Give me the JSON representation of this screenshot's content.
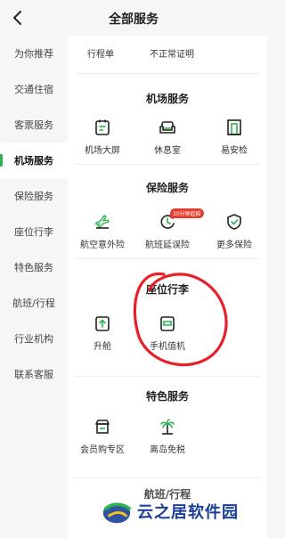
{
  "header": {
    "title": "全部服务"
  },
  "sidebar": {
    "items": [
      {
        "label": "为你推荐"
      },
      {
        "label": "交通住宿"
      },
      {
        "label": "客票服务"
      },
      {
        "label": "机场服务"
      },
      {
        "label": "保险服务"
      },
      {
        "label": "座位行李"
      },
      {
        "label": "特色服务"
      },
      {
        "label": "航班/行程"
      },
      {
        "label": "行业机构"
      },
      {
        "label": "联系客服"
      }
    ]
  },
  "main": {
    "top_items": [
      {
        "label": "行程单"
      },
      {
        "label": "不正常证明"
      }
    ],
    "airport": {
      "title": "机场服务",
      "items": [
        {
          "label": "机场大屏",
          "icon": "flight-board-icon"
        },
        {
          "label": "休息室",
          "icon": "lounge-sofa-icon"
        },
        {
          "label": "易安检",
          "icon": "security-gate-icon"
        }
      ]
    },
    "insurance": {
      "title": "保险服务",
      "items": [
        {
          "label": "航空意外险",
          "icon": "plane-shield-icon"
        },
        {
          "label": "航班延误险",
          "icon": "delay-clock-icon",
          "badge": "30分钟起赔"
        },
        {
          "label": "更多保险",
          "icon": "shield-check-icon"
        }
      ]
    },
    "seat_baggage": {
      "title": "座位行李",
      "items": [
        {
          "label": "升舱",
          "icon": "upgrade-seat-icon"
        },
        {
          "label": "手机值机",
          "icon": "phone-checkin-icon"
        }
      ]
    },
    "special": {
      "title": "特色服务",
      "items": [
        {
          "label": "会员购专区",
          "icon": "shop-icon"
        },
        {
          "label": "离岛免税",
          "icon": "palm-tree-icon"
        }
      ]
    },
    "next_section_title": "航班/行程"
  },
  "watermark": {
    "text": "云之居软件园"
  },
  "colors": {
    "accent": "#2bb24c",
    "badge": "#e63c2f",
    "annotation": "#e8202a",
    "watermark": "#1b3f96"
  }
}
